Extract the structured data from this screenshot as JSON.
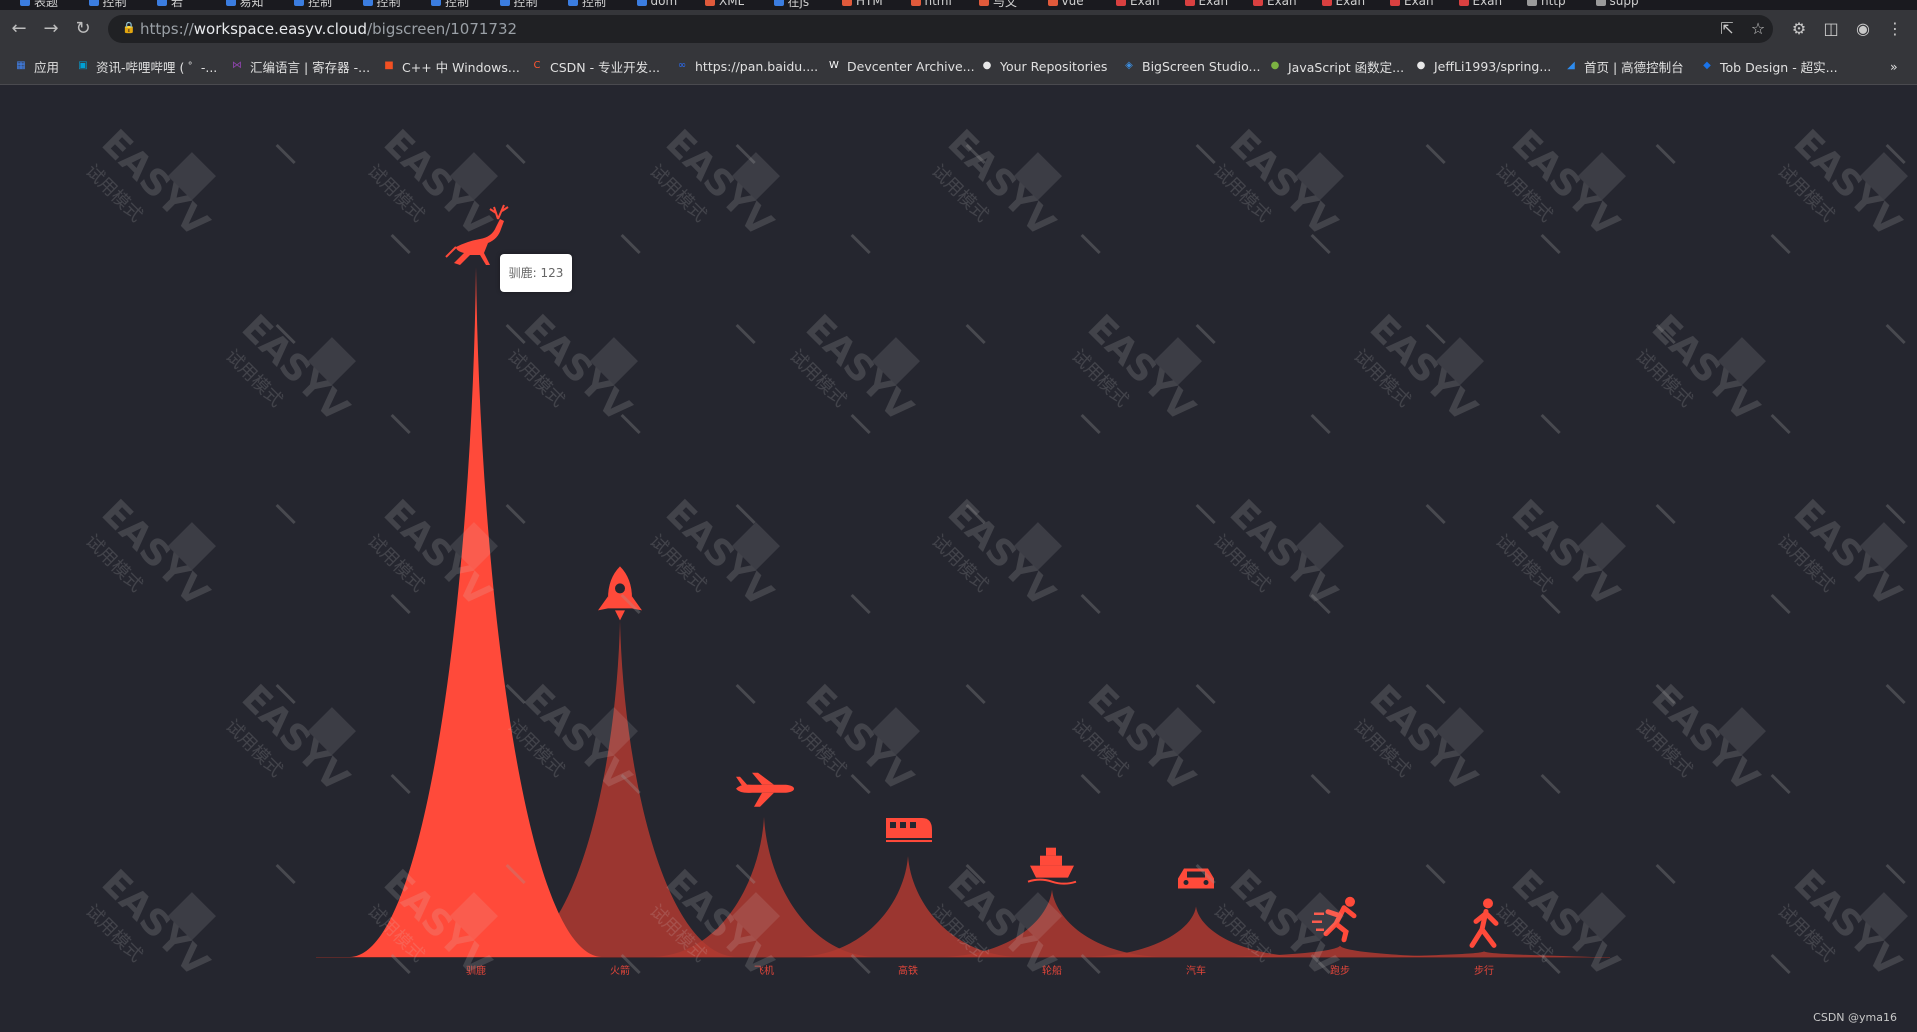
{
  "browser": {
    "tabs": [
      {
        "label": "表题",
        "color": "#3b7de0"
      },
      {
        "label": "控制",
        "color": "#3b7de0"
      },
      {
        "label": "若",
        "color": "#3b7de0"
      },
      {
        "label": "易知",
        "color": "#3b7de0"
      },
      {
        "label": "控制",
        "color": "#3b7de0"
      },
      {
        "label": "控制",
        "color": "#3b7de0"
      },
      {
        "label": "控制",
        "color": "#3b7de0"
      },
      {
        "label": "控制",
        "color": "#3b7de0"
      },
      {
        "label": "控制",
        "color": "#3b7de0"
      },
      {
        "label": "dom",
        "color": "#3b7de0"
      },
      {
        "label": "XML",
        "color": "#e05a3b"
      },
      {
        "label": "在js",
        "color": "#3b7de0"
      },
      {
        "label": "HTM",
        "color": "#e05a3b"
      },
      {
        "label": "html",
        "color": "#e05a3b"
      },
      {
        "label": "与文",
        "color": "#e05a3b"
      },
      {
        "label": "vue",
        "color": "#e05a3b"
      },
      {
        "label": "Exan",
        "color": "#d94040"
      },
      {
        "label": "Exan",
        "color": "#d94040"
      },
      {
        "label": "Exan",
        "color": "#d94040"
      },
      {
        "label": "Exan",
        "color": "#d94040"
      },
      {
        "label": "Exan",
        "color": "#d94040"
      },
      {
        "label": "Exan",
        "color": "#d94040"
      },
      {
        "label": "http",
        "color": "#9a9a9a"
      },
      {
        "label": "supp",
        "color": "#9a9a9a"
      }
    ],
    "url_scheme": "https://",
    "url_host": "workspace.easyv.cloud",
    "url_path": "/bigscreen/1071732",
    "bookmarks": [
      {
        "label": "应用",
        "color": "#4285f4",
        "glyph": "▦"
      },
      {
        "label": "资讯-哔哩哔哩 ( ゜-...",
        "color": "#00a1d6",
        "glyph": "▣"
      },
      {
        "label": "汇编语言 | 寄存器 -...",
        "color": "#8e44ad",
        "glyph": "⋈"
      },
      {
        "label": "C++ 中 Windows...",
        "color": "#f25022",
        "glyph": "■"
      },
      {
        "label": "CSDN - 专业开发...",
        "color": "#fc5531",
        "glyph": "C"
      },
      {
        "label": "https://pan.baidu....",
        "color": "#2b6df5",
        "glyph": "∞"
      },
      {
        "label": "Devcenter Archive...",
        "color": "#ffffff",
        "glyph": "W"
      },
      {
        "label": "Your Repositories",
        "color": "#e8e8e8",
        "glyph": "●"
      },
      {
        "label": "BigScreen Studio...",
        "color": "#3c8dde",
        "glyph": "◈"
      },
      {
        "label": "JavaScript 函数定...",
        "color": "#7cb342",
        "glyph": "●"
      },
      {
        "label": "JeffLi1993/spring...",
        "color": "#e8e8e8",
        "glyph": "●"
      },
      {
        "label": "首页 | 高德控制台",
        "color": "#2d8cf0",
        "glyph": "◢"
      },
      {
        "label": "Tob Design - 超实...",
        "color": "#1a73e8",
        "glyph": "◆"
      }
    ]
  },
  "watermark": {
    "brand": "EASYV",
    "mode": "试用模式"
  },
  "tooltip": {
    "text": "驯鹿: 123"
  },
  "credit": "CSDN @yma16",
  "chart_data": {
    "type": "pictorial-bar",
    "categories": [
      "驯鹿",
      "火箭",
      "飞机",
      "高铁",
      "轮船",
      "汽车",
      "跑步",
      "步行"
    ],
    "values": [
      123,
      60,
      25,
      18,
      12,
      9,
      2,
      1
    ],
    "icons": [
      "deer-icon",
      "rocket-icon",
      "plane-icon",
      "train-icon",
      "ship-icon",
      "car-icon",
      "run-icon",
      "walk-icon"
    ],
    "ylim": [
      0,
      123
    ],
    "grid": false,
    "colors": {
      "highlight": "#ff4a3a",
      "normal": "#b03a30",
      "label": "#e0453a"
    },
    "title": "",
    "xlabel": "",
    "ylabel": ""
  }
}
